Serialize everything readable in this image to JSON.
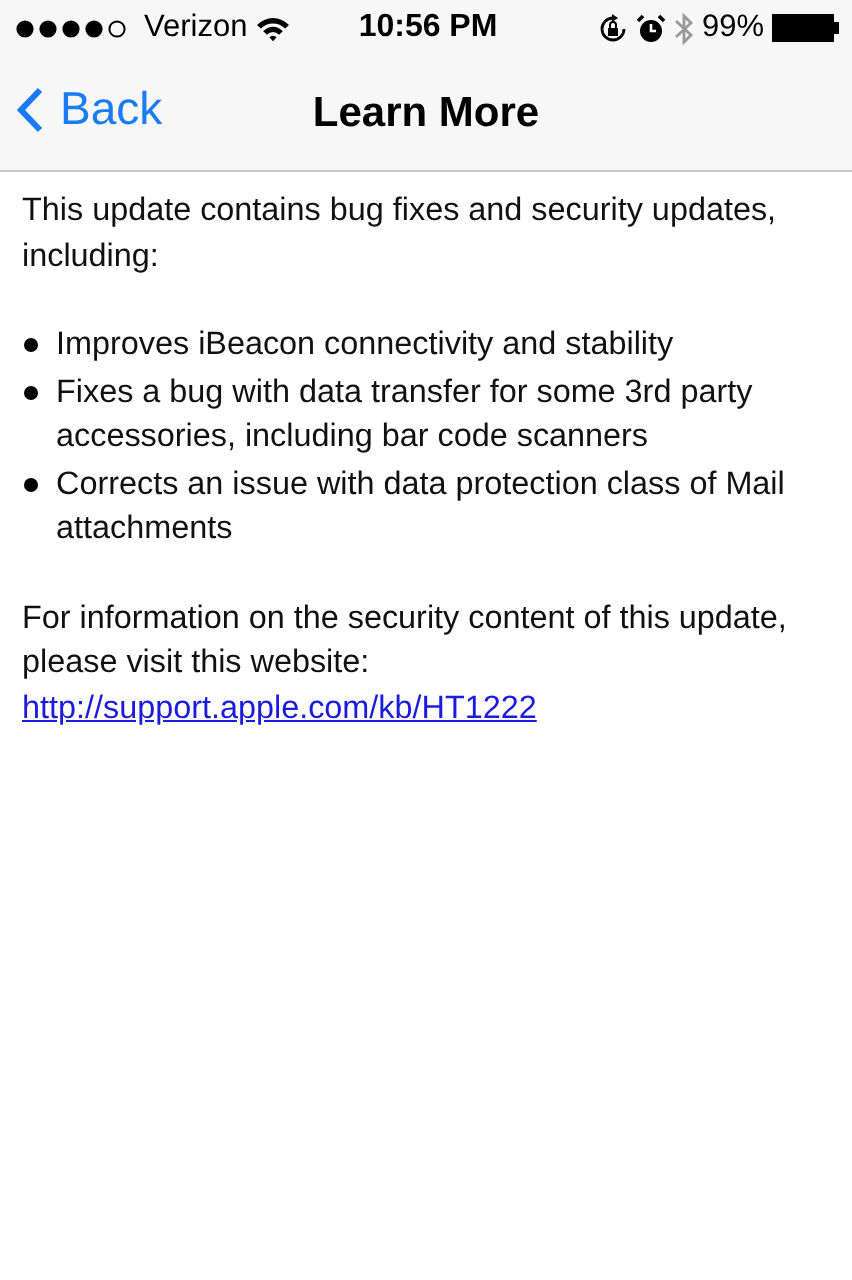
{
  "status_bar": {
    "carrier": "Verizon",
    "time": "10:56 PM",
    "battery": "99%"
  },
  "nav_bar": {
    "back": "Back",
    "title": "Learn More"
  },
  "content": {
    "intro": "This update contains bug fixes and security updates, including:",
    "bullets": [
      "Improves iBeacon connectivity and stability",
      "Fixes a bug with data transfer for some 3rd party accessories, including bar code scanners",
      "Corrects an issue with data protection class of Mail attachments"
    ],
    "info": "For information on the security content of this update, please visit this website:",
    "link": "http://support.apple.com/kb/HT1222"
  }
}
